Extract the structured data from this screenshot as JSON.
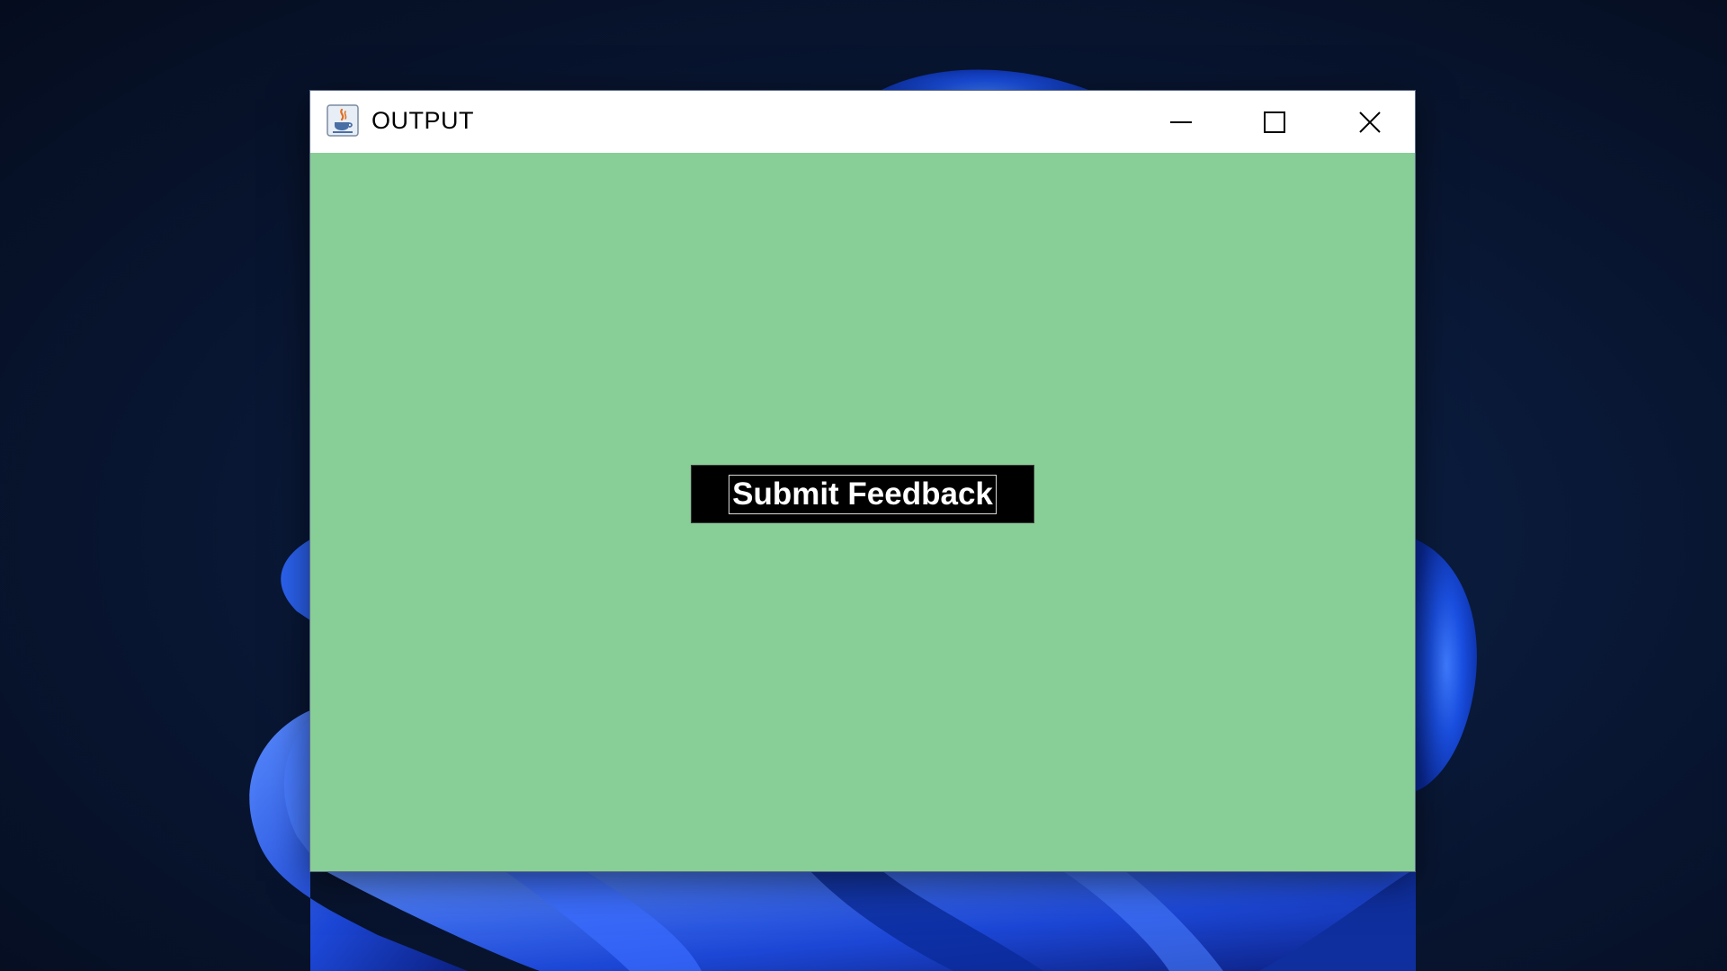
{
  "window": {
    "title": "OUTPUT",
    "app_icon": "java-cup-icon",
    "controls": {
      "minimize_icon": "minimize-icon",
      "maximize_icon": "maximize-icon",
      "close_icon": "close-icon"
    }
  },
  "content": {
    "background_color": "#88ce97",
    "button": {
      "label": "Submit Feedback",
      "background_color": "#000000",
      "text_color": "#ffffff"
    }
  },
  "desktop": {
    "wallpaper": "windows-11-bloom-wallpaper",
    "accent_color": "#1a4fe0"
  }
}
